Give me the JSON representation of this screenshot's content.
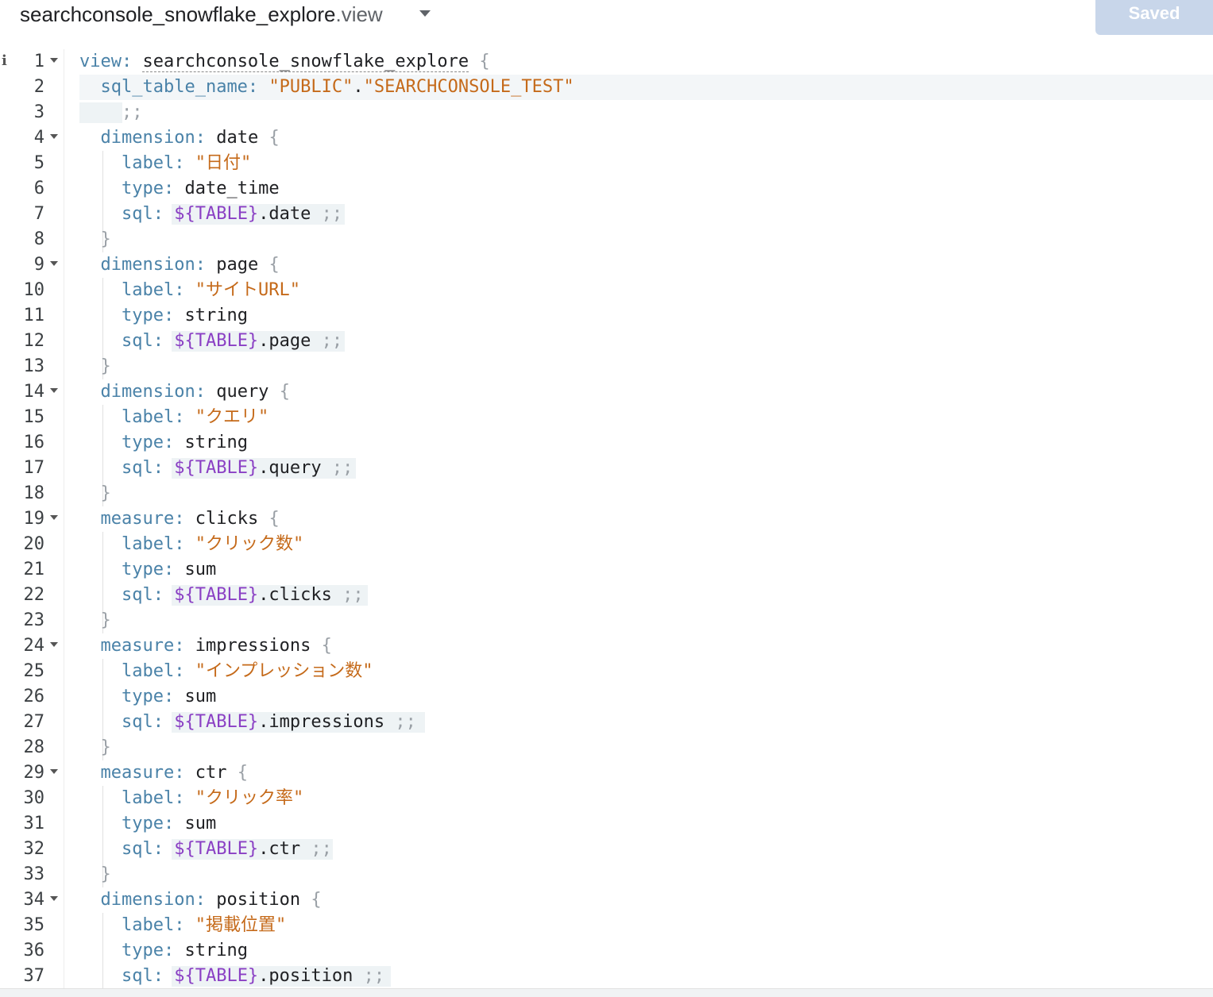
{
  "header": {
    "file_name": "searchconsole_snowflake_explore",
    "file_ext": ".view",
    "saved_label": "Saved"
  },
  "editor": {
    "info_marker": "i",
    "lines": [
      {
        "n": "1",
        "fold": true
      },
      {
        "n": "2"
      },
      {
        "n": "3"
      },
      {
        "n": "4",
        "fold": true
      },
      {
        "n": "5"
      },
      {
        "n": "6"
      },
      {
        "n": "7"
      },
      {
        "n": "8"
      },
      {
        "n": "9",
        "fold": true
      },
      {
        "n": "10"
      },
      {
        "n": "11"
      },
      {
        "n": "12"
      },
      {
        "n": "13"
      },
      {
        "n": "14",
        "fold": true
      },
      {
        "n": "15"
      },
      {
        "n": "16"
      },
      {
        "n": "17"
      },
      {
        "n": "18"
      },
      {
        "n": "19",
        "fold": true
      },
      {
        "n": "20"
      },
      {
        "n": "21"
      },
      {
        "n": "22"
      },
      {
        "n": "23"
      },
      {
        "n": "24",
        "fold": true
      },
      {
        "n": "25"
      },
      {
        "n": "26"
      },
      {
        "n": "27"
      },
      {
        "n": "28"
      },
      {
        "n": "29",
        "fold": true
      },
      {
        "n": "30"
      },
      {
        "n": "31"
      },
      {
        "n": "32"
      },
      {
        "n": "33"
      },
      {
        "n": "34",
        "fold": true
      },
      {
        "n": "35"
      },
      {
        "n": "36"
      },
      {
        "n": "37"
      }
    ],
    "view_keyword": "view:",
    "view_name": "searchconsole_snowflake_explore",
    "sql_table_name_key": "sql_table_name:",
    "sql_table_schema": "\"PUBLIC\"",
    "sql_table_dot": ".",
    "sql_table_table": "\"SEARCHCONSOLE_TEST\"",
    "terminator": ";;",
    "table_ref": "${TABLE}",
    "fields": [
      {
        "kind": "dimension:",
        "name": "date",
        "label": "\"日付\"",
        "type": "date_time",
        "sql_col": ".date"
      },
      {
        "kind": "dimension:",
        "name": "page",
        "label": "\"サイトURL\"",
        "type": "string",
        "sql_col": ".page"
      },
      {
        "kind": "dimension:",
        "name": "query",
        "label": "\"クエリ\"",
        "type": "string",
        "sql_col": ".query"
      },
      {
        "kind": "measure:",
        "name": "clicks",
        "label": "\"クリック数\"",
        "type": "sum",
        "sql_col": ".clicks"
      },
      {
        "kind": "measure:",
        "name": "impressions",
        "label": "\"インプレッション数\"",
        "type": "sum",
        "sql_col": ".impressions"
      },
      {
        "kind": "measure:",
        "name": "ctr",
        "label": "\"クリック率\"",
        "type": "sum",
        "sql_col": ".ctr"
      },
      {
        "kind": "dimension:",
        "name": "position",
        "label": "\"掲載位置\"",
        "type": "string",
        "sql_col": ".position"
      }
    ],
    "label_key": "label:",
    "type_key": "type:",
    "sql_key": "sql:",
    "open_brace": "{",
    "close_brace": "}"
  },
  "colors": {
    "keyword": "#4a82a8",
    "string": "#c56a1a",
    "variable": "#8a3fc4",
    "saved_button_bg": "#c8d6ea"
  }
}
